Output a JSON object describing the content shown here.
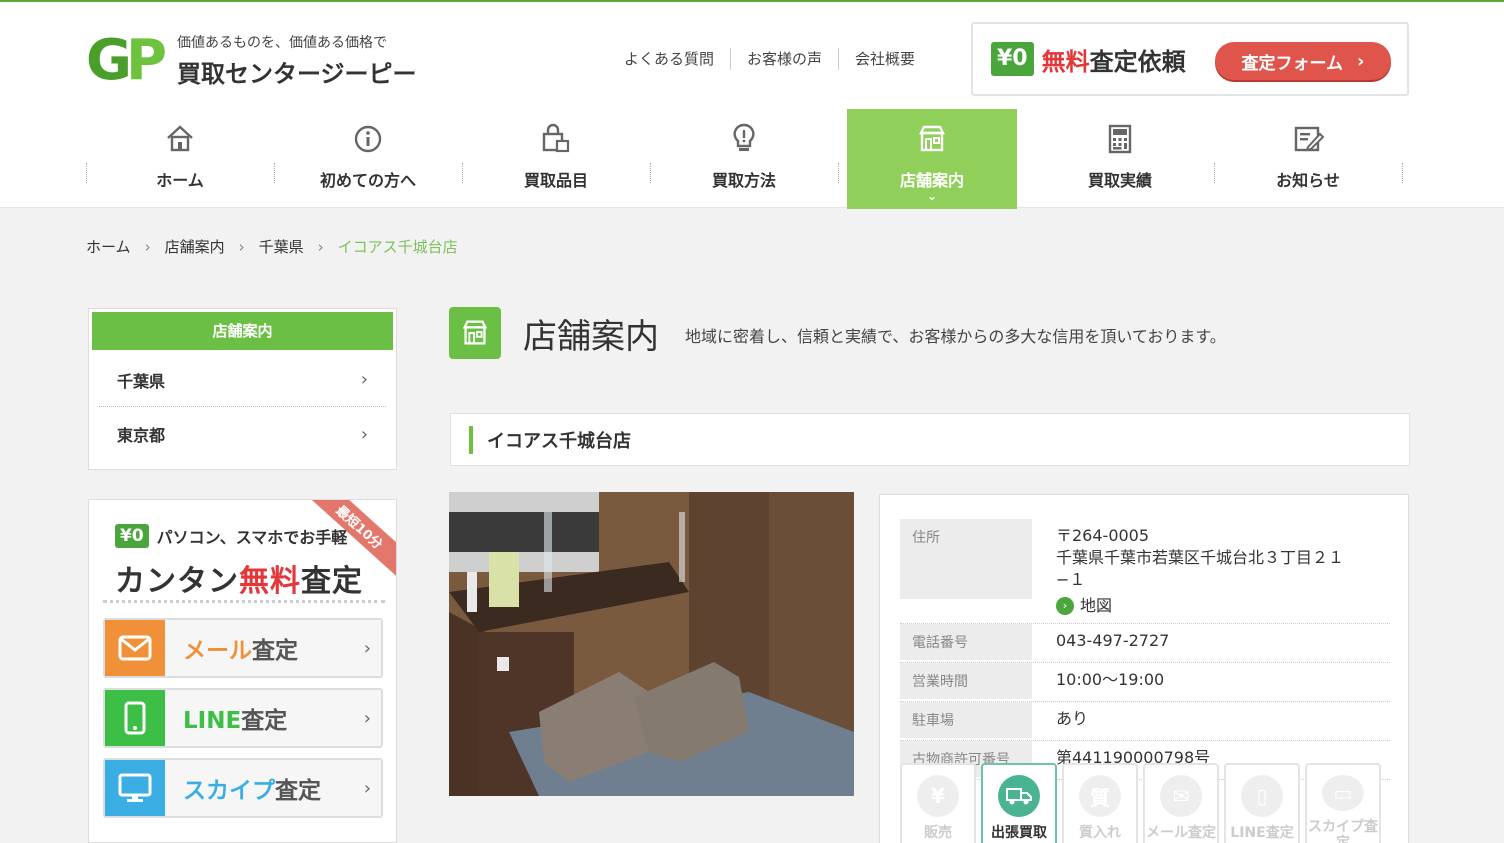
{
  "header": {
    "logo_mark_g": "G",
    "logo_mark_p": "P",
    "logo_sub": "価値あるものを、価値ある価格で",
    "logo_main": "買取センタージーピー",
    "top_links": [
      "よくある質問",
      "お客様の声",
      "会社概要"
    ],
    "cta_yen": "¥0",
    "cta_title_red": "無料",
    "cta_title_rest": "査定依頼",
    "cta_button": "査定フォーム"
  },
  "nav": {
    "items": [
      {
        "label": "ホーム",
        "icon": "home-icon"
      },
      {
        "label": "初めての方へ",
        "icon": "info-icon"
      },
      {
        "label": "買取品目",
        "icon": "bag-icon"
      },
      {
        "label": "買取方法",
        "icon": "lightbulb-icon"
      },
      {
        "label": "店舗案内",
        "icon": "store-icon",
        "active": true
      },
      {
        "label": "買取実績",
        "icon": "calculator-icon"
      },
      {
        "label": "お知らせ",
        "icon": "notepad-icon"
      }
    ]
  },
  "breadcrumb": [
    "ホーム",
    "店舗案内",
    "千葉県",
    "イコアス千城台店"
  ],
  "sidebar": {
    "title": "店舗案内",
    "items": [
      "千葉県",
      "東京都"
    ]
  },
  "assess": {
    "ribbon": "最短10分",
    "yen": "¥0",
    "tagline": "パソコン、スマホでお手軽",
    "big_prefix": "カンタン",
    "big_red": "無料",
    "big_suffix": "査定",
    "buttons": [
      {
        "label_colored": "メール",
        "label_rest": "査定",
        "color": "#f0913a",
        "icon": "mail-icon"
      },
      {
        "label_colored": "LINE",
        "label_rest": "査定",
        "color": "#3dbe47",
        "icon": "smartphone-icon"
      },
      {
        "label_colored": "スカイプ",
        "label_rest": "査定",
        "color": "#3aaee3",
        "icon": "monitor-icon"
      }
    ]
  },
  "page": {
    "title": "店舗案内",
    "description": "地域に密着し、信頼と実績で、お客様からの多大な信用を頂いております。"
  },
  "store": {
    "name": "イコアス千城台店",
    "info": [
      {
        "key": "住所",
        "lines": [
          "〒264-0005",
          "千葉県千葉市若葉区千城台北３丁目２１−１"
        ],
        "map_link": "地図"
      },
      {
        "key": "電話番号",
        "value": "043-497-2727"
      },
      {
        "key": "営業時間",
        "value": "10:00〜19:00"
      },
      {
        "key": "駐車場",
        "value": "あり"
      },
      {
        "key": "古物商許可番号",
        "value": "第441190000798号"
      }
    ],
    "services": [
      {
        "label": "販売",
        "glyph": "¥",
        "active": false
      },
      {
        "label": "出張買取",
        "glyph": "🚚",
        "active": true
      },
      {
        "label": "質入れ",
        "glyph": "質",
        "active": false
      },
      {
        "label": "メール査定",
        "glyph": "✉",
        "active": false
      },
      {
        "label": "LINE査定",
        "glyph": "▯",
        "active": false
      },
      {
        "label": "スカイプ査定",
        "glyph": "▭",
        "active": false
      }
    ]
  },
  "colors": {
    "brand_green": "#6cbf45",
    "nav_active": "#8fcf5a",
    "accent_red": "#e4373a",
    "cta_button": "#e0554b"
  }
}
